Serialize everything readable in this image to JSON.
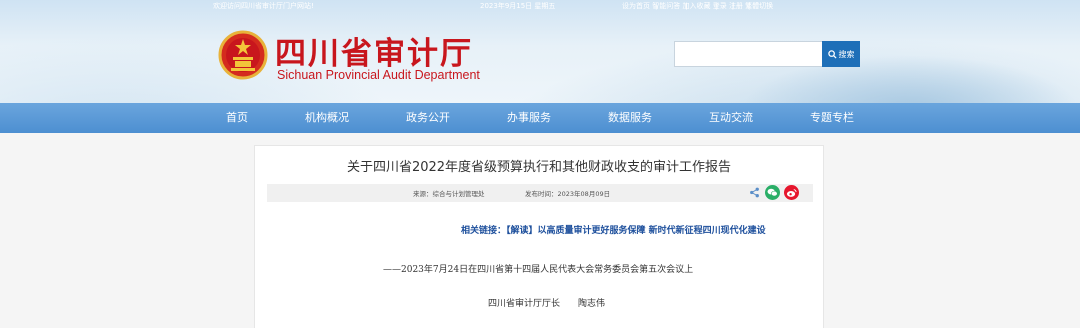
{
  "topbar": {
    "welcome": "欢迎访问四川省审计厅门户网站!",
    "date": "2023年9月15日 星期五",
    "links": [
      "设为首页",
      "智能问答",
      "加入收藏",
      "登录",
      "注册",
      "繁體切换"
    ]
  },
  "header": {
    "title": "四川省审计厅",
    "subtitle": "Sichuan Provincial Audit Department",
    "emblem_icon": "national-emblem-icon",
    "brand_color": "#c8161d"
  },
  "search": {
    "placeholder": "",
    "button_label": "搜索",
    "button_icon": "search-icon",
    "button_color": "#1e6fb8"
  },
  "nav": {
    "items": [
      "首页",
      "机构概况",
      "政务公开",
      "办事服务",
      "数据服务",
      "互动交流",
      "专题专栏"
    ],
    "color": "#4d8fd1"
  },
  "article": {
    "title": "关于四川省2022年度省级预算执行和其他财政收支的审计工作报告",
    "source": "来源：综合与计划管理处",
    "publish_date": "发布时间：2023年08月09日",
    "share_icons": [
      "share-icon",
      "wechat-icon",
      "weibo-icon"
    ],
    "related_label": "相关链接：",
    "related_link": "【解读】以高质量审计更好服务保障 新时代新征程四川现代化建设",
    "subtitle": "——2023年7月24日在四川省第十四届人民代表大会常务委员会第五次会议上",
    "author_title": "四川省审计厅厅长",
    "author_name": "陶志伟"
  }
}
